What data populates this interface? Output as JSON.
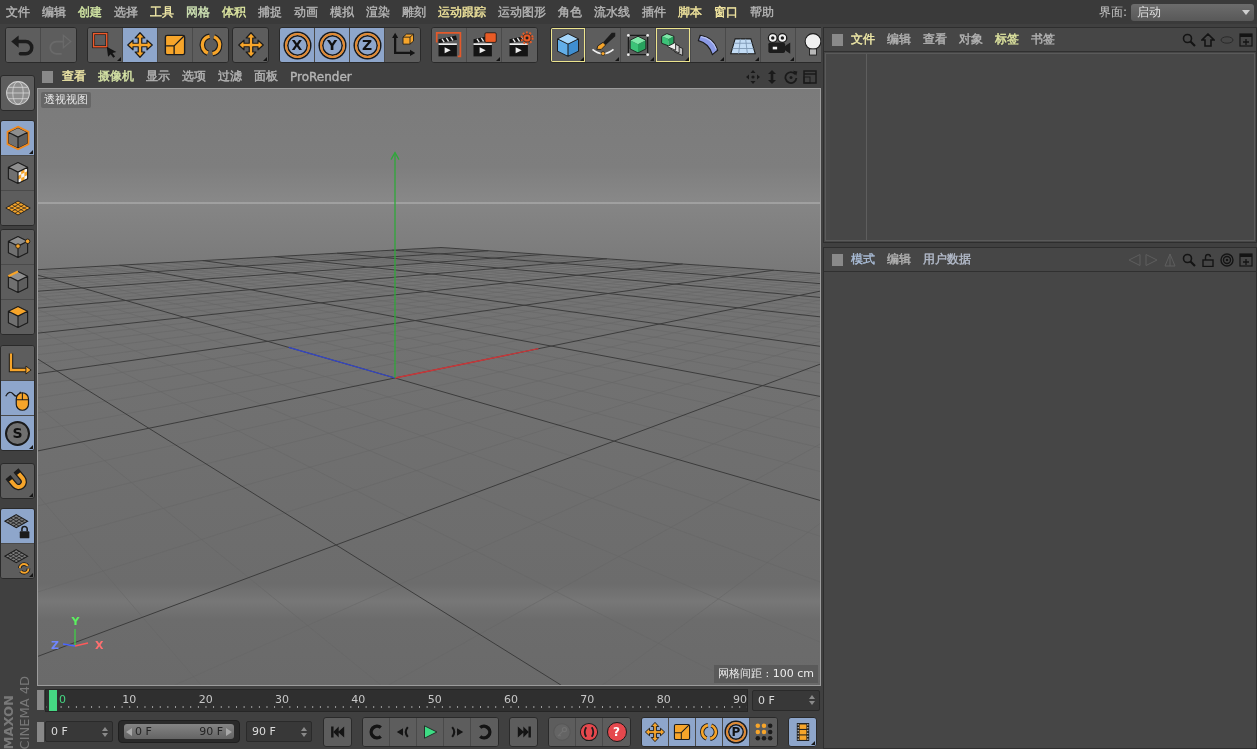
{
  "menubar": {
    "items": [
      {
        "label": "文件",
        "color": "#b4b4b4"
      },
      {
        "label": "编辑",
        "color": "#b4b4b4"
      },
      {
        "label": "创建",
        "color": "#d2e6a4"
      },
      {
        "label": "选择",
        "color": "#b4b4b4"
      },
      {
        "label": "工具",
        "color": "#f2eaa8"
      },
      {
        "label": "网格",
        "color": "#cfe3b4"
      },
      {
        "label": "体积",
        "color": "#dfe8a2"
      },
      {
        "label": "捕捉",
        "color": "#b4b4b4"
      },
      {
        "label": "动画",
        "color": "#b4b4b4"
      },
      {
        "label": "模拟",
        "color": "#b4b4b4"
      },
      {
        "label": "渲染",
        "color": "#b4b4b4"
      },
      {
        "label": "雕刻",
        "color": "#b4b4b4"
      },
      {
        "label": "运动跟踪",
        "color": "#f0e49c"
      },
      {
        "label": "运动图形",
        "color": "#b4b4b4"
      },
      {
        "label": "角色",
        "color": "#b4b4b4"
      },
      {
        "label": "流水线",
        "color": "#b4b4b4"
      },
      {
        "label": "插件",
        "color": "#b4b4b4"
      },
      {
        "label": "脚本",
        "color": "#f0e49c"
      },
      {
        "label": "窗口",
        "color": "#f5e9a2"
      },
      {
        "label": "帮助",
        "color": "#b4b4b4"
      }
    ],
    "layout": {
      "label": "界面:",
      "value": "启动"
    }
  },
  "toolbar": {
    "groups": [
      [
        {
          "kind": "undo",
          "selected": false,
          "highlighted": false,
          "disabled": false,
          "submenu": false
        },
        {
          "kind": "redo",
          "selected": false,
          "highlighted": false,
          "disabled": true,
          "submenu": false
        }
      ],
      [
        {
          "kind": "live_select",
          "selected": false,
          "highlighted": false,
          "disabled": false,
          "submenu": true
        },
        {
          "kind": "move",
          "selected": true,
          "highlighted": false,
          "disabled": false,
          "submenu": false
        },
        {
          "kind": "scale",
          "selected": false,
          "highlighted": false,
          "disabled": false,
          "submenu": false
        },
        {
          "kind": "rotate",
          "selected": false,
          "highlighted": false,
          "disabled": false,
          "submenu": false
        }
      ],
      [
        {
          "kind": "move",
          "selected": false,
          "highlighted": false,
          "disabled": false,
          "submenu": true
        }
      ],
      [
        {
          "kind": "ring",
          "label": "X",
          "selected": true,
          "highlighted": false,
          "disabled": false,
          "submenu": false
        },
        {
          "kind": "ring",
          "label": "Y",
          "selected": true,
          "highlighted": false,
          "disabled": false,
          "submenu": false
        },
        {
          "kind": "ring",
          "label": "Z",
          "selected": true,
          "highlighted": false,
          "disabled": false,
          "submenu": false
        },
        {
          "kind": "coords",
          "selected": false,
          "highlighted": false,
          "disabled": false,
          "submenu": false
        }
      ],
      [
        {
          "kind": "render_view",
          "selected": false,
          "highlighted": false,
          "disabled": false,
          "submenu": false
        },
        {
          "kind": "render_pv",
          "selected": false,
          "highlighted": false,
          "disabled": false,
          "submenu": true
        },
        {
          "kind": "render_settings",
          "selected": false,
          "highlighted": false,
          "disabled": false,
          "submenu": false
        }
      ],
      [
        {
          "kind": "cube",
          "selected": false,
          "highlighted": true,
          "disabled": false,
          "submenu": true
        },
        {
          "kind": "pen",
          "selected": false,
          "highlighted": false,
          "disabled": false,
          "submenu": true
        },
        {
          "kind": "subdivision",
          "selected": false,
          "highlighted": false,
          "disabled": false,
          "submenu": true
        },
        {
          "kind": "cloner",
          "selected": false,
          "highlighted": true,
          "disabled": false,
          "submenu": true
        },
        {
          "kind": "bend",
          "selected": false,
          "highlighted": false,
          "disabled": false,
          "submenu": true
        },
        {
          "kind": "plane",
          "selected": false,
          "highlighted": false,
          "disabled": false,
          "submenu": true
        },
        {
          "kind": "camera",
          "selected": false,
          "highlighted": false,
          "disabled": false,
          "submenu": true
        },
        {
          "kind": "light",
          "selected": false,
          "highlighted": false,
          "disabled": false,
          "submenu": false
        }
      ]
    ]
  },
  "mode_bar": {
    "groups": [
      [
        {
          "kind": "globe",
          "selected": false,
          "submenu": false
        }
      ],
      [
        {
          "kind": "model",
          "selected": true,
          "submenu": true
        },
        {
          "kind": "texture",
          "selected": false,
          "submenu": false
        },
        {
          "kind": "workplane",
          "selected": false,
          "submenu": false
        }
      ],
      [
        {
          "kind": "points",
          "selected": false,
          "submenu": false
        },
        {
          "kind": "edges",
          "selected": false,
          "submenu": false
        },
        {
          "kind": "polygons",
          "selected": false,
          "submenu": false
        }
      ],
      [
        {
          "kind": "axis",
          "selected": false,
          "submenu": false
        },
        {
          "kind": "tweak",
          "selected": true,
          "submenu": false
        },
        {
          "kind": "disc",
          "label": "S",
          "selected": true,
          "submenu": true
        }
      ],
      [
        {
          "kind": "magnet",
          "selected": false,
          "submenu": true
        }
      ],
      [
        {
          "kind": "grid_lock",
          "selected": true,
          "submenu": false
        },
        {
          "kind": "grid_rotate",
          "selected": false,
          "submenu": true
        }
      ]
    ]
  },
  "viewport": {
    "menu": [
      {
        "label": "查看",
        "color": "#f0e8a8"
      },
      {
        "label": "摄像机",
        "color": "#d6e4a6"
      },
      {
        "label": "显示",
        "color": "#b4b4b4"
      },
      {
        "label": "选项",
        "color": "#b4b4b4"
      },
      {
        "label": "过滤",
        "color": "#b4b4b4"
      },
      {
        "label": "面板",
        "color": "#b4b4b4"
      },
      {
        "label": "ProRender",
        "color": "#b4b4b4"
      }
    ],
    "view_name": "透视视图",
    "grid_spacing": "网格间距 : 100 cm",
    "gizmo": {
      "y": "Y",
      "z": "Z",
      "x": "X"
    }
  },
  "timeline": {
    "ticks": [
      "10",
      "20",
      "30",
      "40",
      "50",
      "60",
      "70",
      "80",
      "90"
    ],
    "playhead": {
      "label": "0",
      "level": 0
    },
    "frame_field": "0 F"
  },
  "playback": {
    "start_field": "0 F",
    "range": {
      "start": "0 F",
      "end": "90 F",
      "level": 1
    },
    "end_field": "90 F",
    "groups": [
      [
        {
          "kind": "skip_start",
          "selected": false,
          "disabled": false,
          "submenu": false
        }
      ],
      [
        {
          "kind": "prev_key",
          "selected": false,
          "disabled": false,
          "submenu": false
        },
        {
          "kind": "prev_frame",
          "selected": false,
          "disabled": false,
          "submenu": false
        },
        {
          "kind": "play",
          "selected": false,
          "disabled": false,
          "submenu": false
        },
        {
          "kind": "next_frame",
          "selected": false,
          "disabled": false,
          "submenu": false
        },
        {
          "kind": "next_key",
          "selected": false,
          "disabled": false,
          "submenu": false
        }
      ],
      [
        {
          "kind": "skip_end",
          "selected": false,
          "disabled": false,
          "submenu": false
        }
      ],
      [
        {
          "kind": "key",
          "selected": false,
          "disabled": true,
          "submenu": false
        },
        {
          "kind": "record",
          "selected": false,
          "disabled": false,
          "submenu": false
        },
        {
          "kind": "red_disc",
          "label": "?",
          "selected": false,
          "disabled": false,
          "submenu": false
        }
      ],
      [
        {
          "kind": "move",
          "selected": true,
          "disabled": false,
          "submenu": false
        },
        {
          "kind": "scale",
          "selected": true,
          "disabled": false,
          "submenu": false
        },
        {
          "kind": "rotate",
          "selected": true,
          "disabled": false,
          "submenu": false
        },
        {
          "kind": "ring",
          "label": "P",
          "selected": true,
          "disabled": false,
          "submenu": false
        },
        {
          "kind": "dots",
          "selected": false,
          "disabled": false,
          "submenu": false
        }
      ],
      [
        {
          "kind": "film",
          "selected": true,
          "disabled": false,
          "submenu": true
        }
      ]
    ]
  },
  "logo": {
    "brand": "MAXON",
    "product": "CINEMA 4D"
  },
  "object_manager": {
    "menu": [
      {
        "label": "文件",
        "color": "#f0eaa8"
      },
      {
        "label": "编辑",
        "color": "#b4b4b4"
      },
      {
        "label": "查看",
        "color": "#b4b4b4"
      },
      {
        "label": "对象",
        "color": "#b4b4b4"
      },
      {
        "label": "标签",
        "color": "#e0e6a0"
      },
      {
        "label": "书签",
        "color": "#b4b4b4"
      }
    ]
  },
  "attribute_manager": {
    "menu": [
      {
        "label": "模式",
        "color": "#a9bcd6"
      },
      {
        "label": "编辑",
        "color": "#b4b4b4"
      },
      {
        "label": "用户数据",
        "color": "#b4bccb"
      }
    ]
  }
}
